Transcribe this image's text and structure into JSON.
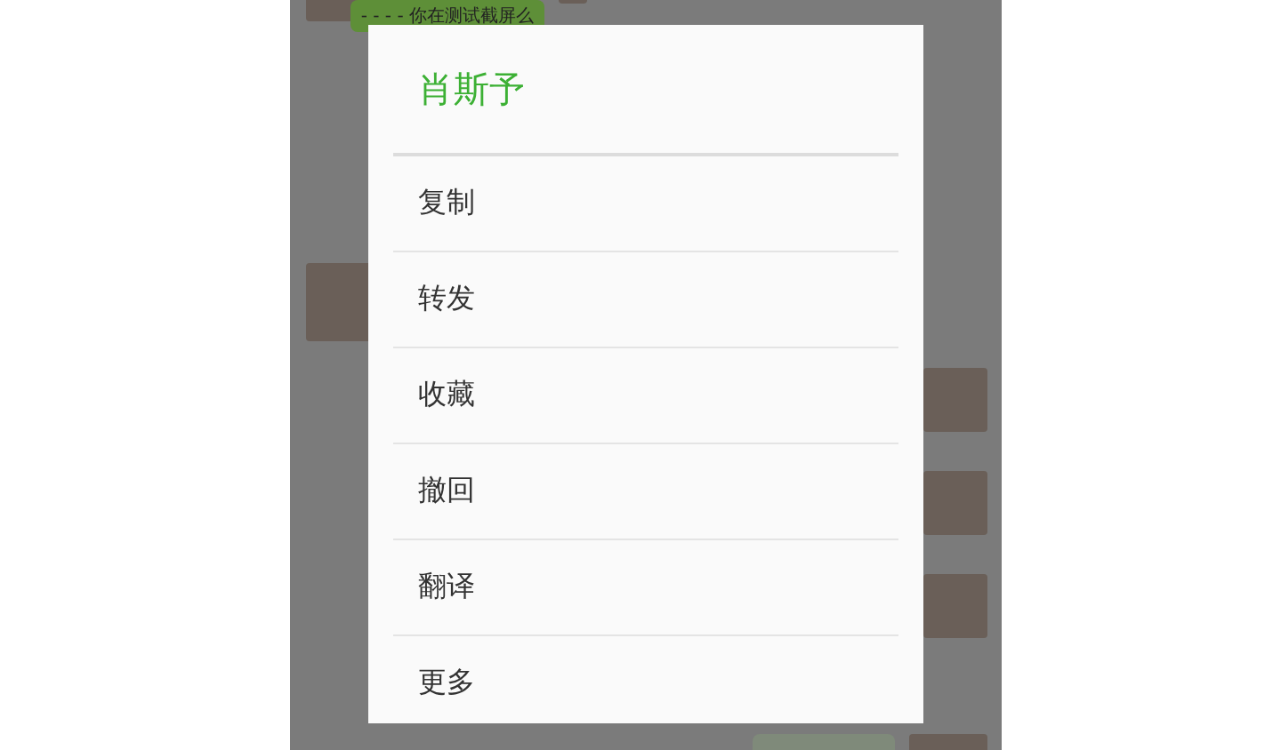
{
  "chat": {
    "messages": [
      {
        "kind": "incoming"
      },
      {
        "kind": "outgoing",
        "text": "- - - - 你在测试截屏么"
      },
      {
        "kind": "incoming"
      },
      {
        "kind": "outgoing"
      },
      {
        "kind": "outgoing"
      },
      {
        "kind": "outgoing"
      },
      {
        "kind": "outgoing"
      }
    ]
  },
  "dialog": {
    "title": "肖斯予",
    "items": [
      {
        "label": "复制"
      },
      {
        "label": "转发"
      },
      {
        "label": "收藏"
      },
      {
        "label": "撤回"
      },
      {
        "label": "翻译"
      },
      {
        "label": "更多"
      }
    ]
  }
}
